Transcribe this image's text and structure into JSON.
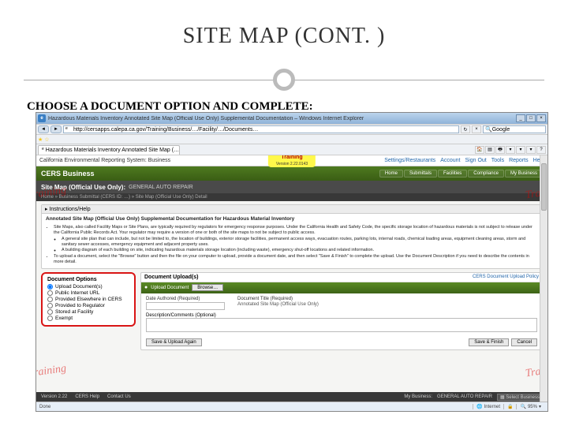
{
  "slide": {
    "title": "SITE MAP (CONT. )",
    "subtitle": "CHOOSE A DOCUMENT OPTION AND COMPLETE:"
  },
  "browser": {
    "window_title": "Hazardous Materials Inventory Annotated Site Map (Official Use Only) Supplemental Documentation – Windows Internet Explorer",
    "url": "http://cersapps.calepa.ca.gov/Training/Business/…/Facility/…/Documents…",
    "search_placeholder": "Google",
    "tab_label": "Hazardous Materials Inventory Annotated Site Map (…",
    "win_buttons": {
      "min": "_",
      "max": "□",
      "close": "×"
    }
  },
  "app": {
    "header_title": "California Environmental Reporting System: Business",
    "training_badge": "Training",
    "training_version": "Version 2.22.0143",
    "top_links": [
      "Settings/Restaurants",
      "Account",
      "Sign Out",
      "Tools",
      "Reports",
      "Help"
    ]
  },
  "green_nav": {
    "logo": "CERS Business",
    "tabs": [
      "Home",
      "Submittals",
      "Facilities",
      "Compliance",
      "My Business"
    ]
  },
  "dark_bar": {
    "title": "Site Map (Official Use Only):",
    "subtitle": "GENERAL AUTO REPAIR",
    "breadcrumb": "Home » Business Submittal (CERS ID: …) » Site Map (Official Use Only) Detail"
  },
  "instructions": {
    "header": "Instructions/Help",
    "title": "Annotated Site Map (Official Use Only) Supplemental Documentation for Hazardous Material Inventory",
    "bullets": [
      "Site Maps, also called Facility Maps or Site Plans, are typically required by regulators for emergency response purposes. Under the California Health and Safety Code, the specific storage location of hazardous materials is not subject to release under the California Public Records Act. Your regulator may require a version of one or both of the site maps to not be subject to public access.",
      "A general site plan that can include, but not be limited to, the location of buildings, exterior storage facilities, permanent access ways, evacuation routes, parking lots, internal roads, chemical loading areas, equipment cleaning areas, storm and sanitary sewer accesses, emergency equipment and adjacent property uses.",
      "A building diagram of each building on site, indicating hazardous materials storage location (including waste), emergency shut-off locations and related information.",
      "To upload a document, select the \"Browse\" button and then the file on your computer to upload, provide a document date, and then select \"Save & Finish\" to complete the upload. Use the Document Description if you need to describe the contents in more detail."
    ]
  },
  "doc_options": {
    "title": "Document Options",
    "options": [
      "Upload Document(s)",
      "Public Internet URL",
      "Provided Elsewhere in CERS",
      "Provided to Regulator",
      "Stored at Facility",
      "Exempt"
    ]
  },
  "upload": {
    "title": "Document Upload(s)",
    "policy_link": "CERS Document Upload Policy",
    "bar_label": "Upload Document",
    "browse": "Browse…",
    "date_label": "Date Authored (Required)",
    "name_label": "Document Title (Required)",
    "name_value": "Annotated Site Map (Official Use Only)",
    "desc_label": "Description/Comments (Optional)",
    "btn_save_again": "Save & Upload Again",
    "btn_save_finish": "Save & Finish",
    "btn_cancel": "Cancel"
  },
  "footer": {
    "left": [
      "Version 2.22",
      "CERS Help",
      "Contact Us"
    ],
    "right_label": "My Business:",
    "right_value": "GENERAL AUTO REPAIR",
    "select": "Select Business"
  },
  "status": {
    "done": "Done",
    "internet": "Internet",
    "zoom": "95%"
  },
  "watermark": "Training"
}
